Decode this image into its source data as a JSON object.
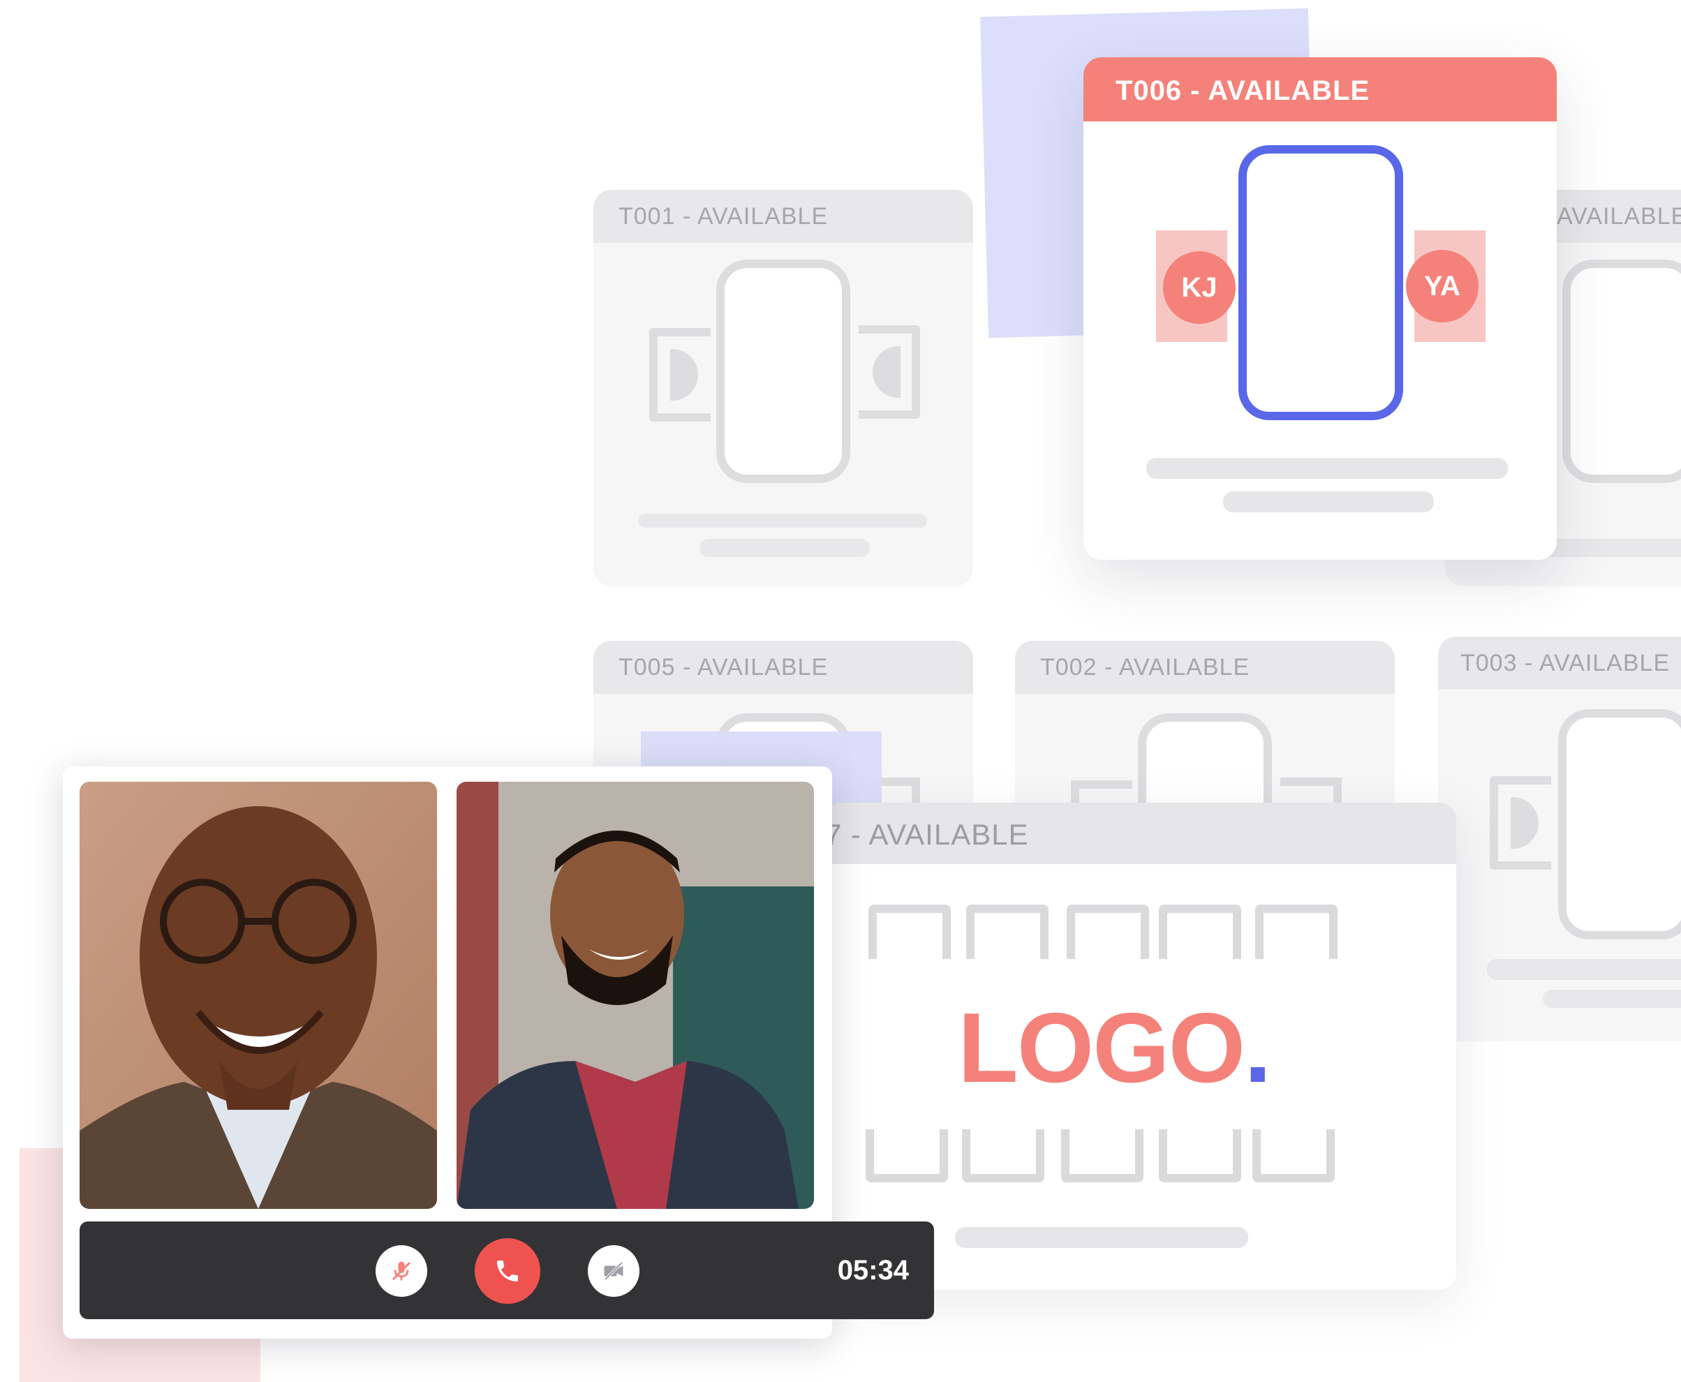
{
  "tables": {
    "t001": {
      "header": "T001 - AVAILABLE"
    },
    "t006": {
      "header": "T006 - AVAILABLE",
      "seat_left": "KJ",
      "seat_right": "YA"
    },
    "t004": {
      "header": "AVAILABLE"
    },
    "t005": {
      "header": "T005 - AVAILABLE"
    },
    "t002": {
      "header": "T002 - AVAILABLE"
    },
    "t003": {
      "header": "T003 - AVAILABLE"
    },
    "t007": {
      "header": "7 - AVAILABLE",
      "logo_text": "LOGO",
      "logo_dot": "."
    }
  },
  "call": {
    "timer": "05:34",
    "controls": [
      "mute-microphone",
      "end-call",
      "disable-camera"
    ]
  },
  "colors": {
    "accent_red": "#f4827a",
    "table_blue": "#5a67e8",
    "call_bar": "#333335"
  }
}
